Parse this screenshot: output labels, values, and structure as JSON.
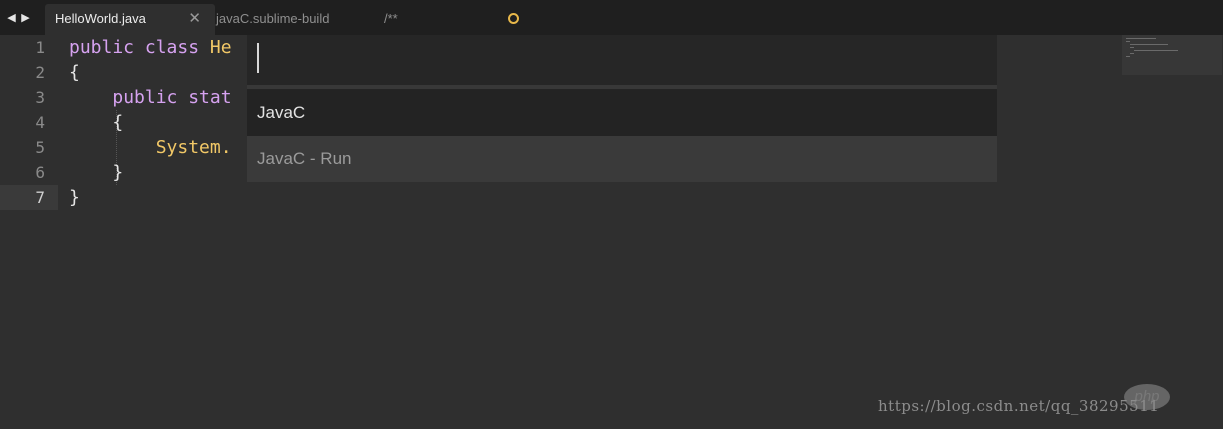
{
  "tabs": [
    {
      "label": "HelloWorld.java",
      "active": true
    },
    {
      "label": "javaC.sublime-build",
      "active": false
    },
    {
      "label": "/**",
      "active": false,
      "unsaved": true
    }
  ],
  "editor": {
    "line_numbers": [
      "1",
      "2",
      "3",
      "4",
      "5",
      "6",
      "7"
    ],
    "current_line": 7,
    "lines": [
      {
        "kw": "public class ",
        "ident": "He"
      },
      {
        "text": "{"
      },
      {
        "kw": "public stat",
        "indent": "    "
      },
      {
        "text": "    {"
      },
      {
        "obj": "System.",
        "indent": "        "
      },
      {
        "text": "    }"
      },
      {
        "text": "}"
      }
    ]
  },
  "palette": {
    "input_value": "",
    "items": [
      "JavaC",
      "JavaC - Run"
    ],
    "selected_index": 1
  },
  "watermark": {
    "text": "https://blog.csdn.net/qq_38295511",
    "logo": "php"
  },
  "colors": {
    "background": "#2f2f2f",
    "tabbar": "#1f1f1f",
    "keyword": "#d6a2f0",
    "type": "#f2c867",
    "dirty_indicator": "#e8b84a"
  }
}
